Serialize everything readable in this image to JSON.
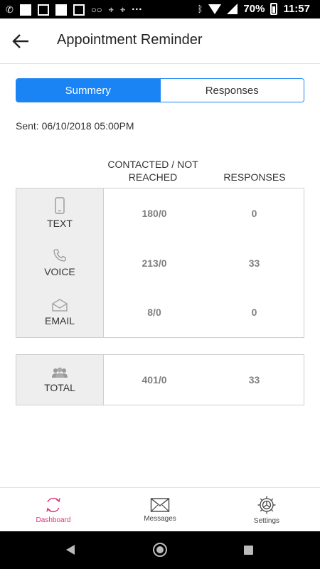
{
  "status_bar": {
    "battery": "70%",
    "time": "11:57",
    "dots": "···"
  },
  "app_bar": {
    "title": "Appointment Reminder"
  },
  "tabs": [
    {
      "label": "Summery",
      "active": true
    },
    {
      "label": "Responses",
      "active": false
    }
  ],
  "sent": "Sent: 06/10/2018 05:00PM",
  "columns": {
    "contacted": "CONTACTED / NOT REACHED",
    "responses": "RESPONSES"
  },
  "rows": [
    {
      "label": "TEXT",
      "icon": "phone-icon",
      "contacted": "180/0",
      "responses": "0"
    },
    {
      "label": "VOICE",
      "icon": "handset-icon",
      "contacted": "213/0",
      "responses": "33"
    },
    {
      "label": "EMAIL",
      "icon": "envelope-icon",
      "contacted": "8/0",
      "responses": "0"
    }
  ],
  "total": {
    "label": "TOTAL",
    "icon": "group-icon",
    "contacted": "401/0",
    "responses": "33"
  },
  "bottom_nav": [
    {
      "label": "Dashboard",
      "icon": "refresh-icon",
      "active": true
    },
    {
      "label": "Messages",
      "icon": "envelope-icon",
      "active": false
    },
    {
      "label": "Settings",
      "icon": "gear-icon",
      "active": false
    }
  ],
  "colors": {
    "accent": "#1a84f5",
    "active_nav": "#e0307a",
    "value_text": "#808080"
  }
}
